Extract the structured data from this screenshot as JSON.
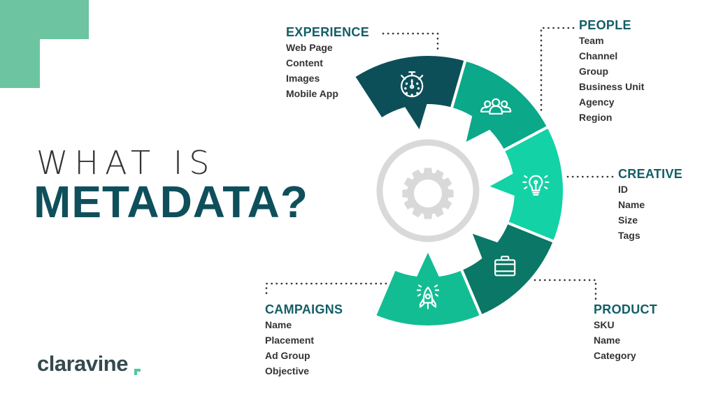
{
  "title": {
    "line1": "WHAT IS",
    "line2": "METADATA?"
  },
  "colors": {
    "corner": "#6cc4a1",
    "title_dark": "#0f4f5c",
    "heading": "#135e68",
    "text": "#333333",
    "gear": "#d9d9d9",
    "dots": "#333333"
  },
  "categories": [
    {
      "key": "experience",
      "title": "EXPERIENCE",
      "icon": "stopwatch-icon",
      "color": "#0d4f59",
      "items": [
        "Web Page",
        "Content",
        "Images",
        "Mobile App"
      ]
    },
    {
      "key": "people",
      "title": "PEOPLE",
      "icon": "people-group-icon",
      "color": "#0ba88a",
      "items": [
        "Team",
        "Channel",
        "Group",
        "Business Unit",
        "Agency",
        "Region"
      ]
    },
    {
      "key": "creative",
      "title": "CREATIVE",
      "icon": "lightbulb-icon",
      "color": "#12d2a6",
      "items": [
        "ID",
        "Name",
        "Size",
        "Tags"
      ]
    },
    {
      "key": "product",
      "title": "PRODUCT",
      "icon": "briefcase-icon",
      "color": "#0b7766",
      "items": [
        "SKU",
        "Name",
        "Category"
      ]
    },
    {
      "key": "campaigns",
      "title": "CAMPAIGNS",
      "icon": "rocket-icon",
      "color": "#13bd93",
      "items": [
        "Name",
        "Placement",
        "Ad Group",
        "Objective"
      ]
    }
  ],
  "center_icon": "gear-icon",
  "logo": {
    "text": "claravine",
    "accent": "#4fc79c"
  }
}
